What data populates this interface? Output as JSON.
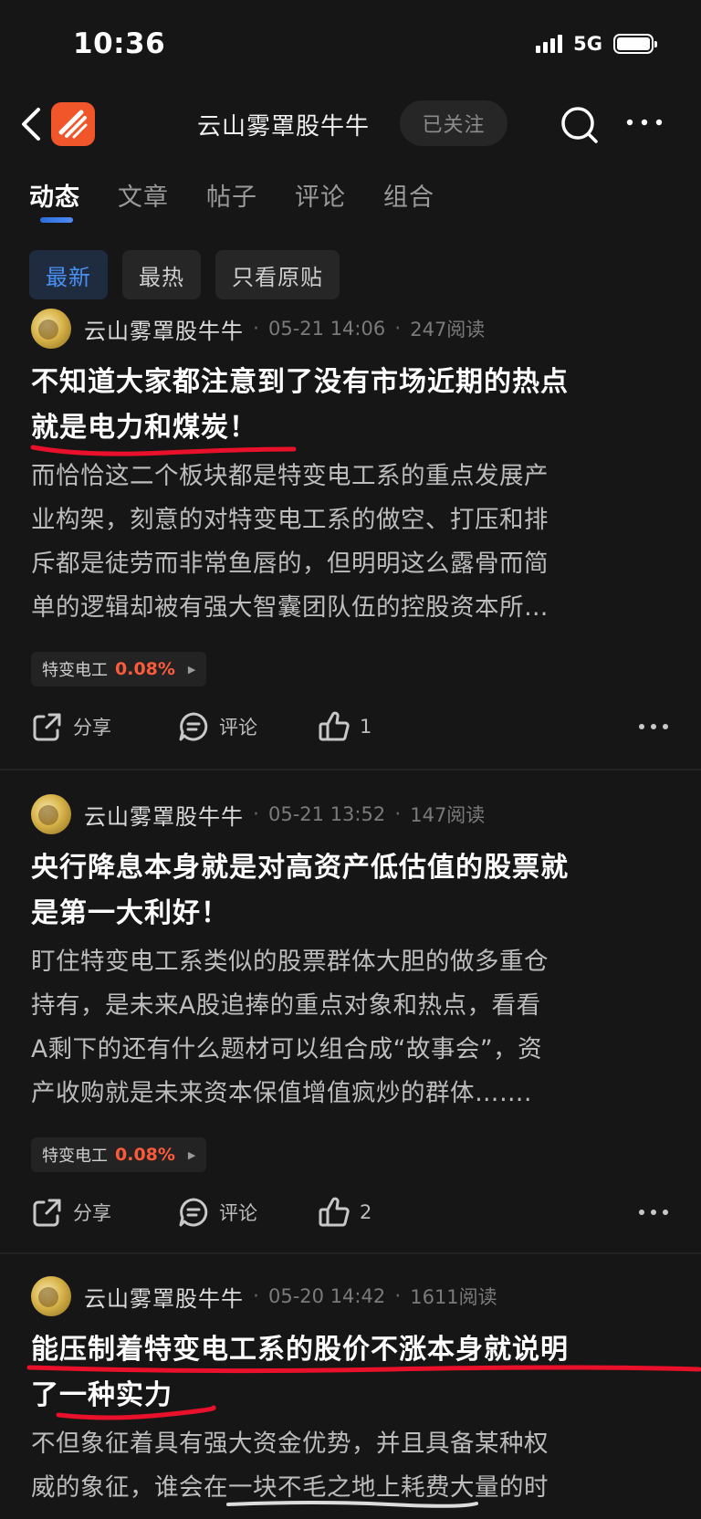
{
  "status_bar": {
    "time": "10:36",
    "network": "5G"
  },
  "header": {
    "title": "云山雾罩股牛牛",
    "follow_label": "已关注"
  },
  "tabs": [
    {
      "label": "动态",
      "active": true
    },
    {
      "label": "文章",
      "active": false
    },
    {
      "label": "帖子",
      "active": false
    },
    {
      "label": "评论",
      "active": false
    },
    {
      "label": "组合",
      "active": false
    }
  ],
  "filters": [
    {
      "label": "最新",
      "active": true
    },
    {
      "label": "最热",
      "active": false
    },
    {
      "label": "只看原贴",
      "active": false
    }
  ],
  "posts": [
    {
      "author": "云山雾罩股牛牛",
      "time": "05-21 14:06",
      "reads": "247阅读",
      "title_lines": [
        "不知道大家都注意到了没有市场近期的热点",
        "就是电力和煤炭！"
      ],
      "body_lines": [
        "而恰恰这二个板块都是特变电工系的重点发展产",
        "业构架，刻意的对特变电工系的做空、打压和排",
        "斥都是徒劳而非常鱼唇的，但明明这么露骨而简",
        "单的逻辑却被有强大智囊团队伍的控股资本所…"
      ],
      "stock": {
        "name": "特变电工",
        "change": "0.08%"
      },
      "share_label": "分享",
      "comment_label": "评论",
      "like_count": "1"
    },
    {
      "author": "云山雾罩股牛牛",
      "time": "05-21 13:52",
      "reads": "147阅读",
      "title_lines": [
        "央行降息本身就是对高资产低估值的股票就",
        "是第一大利好！"
      ],
      "body_lines": [
        "盯住特变电工系类似的股票群体大胆的做多重仓",
        "持有，是未来A股追捧的重点对象和热点，看看",
        "A剩下的还有什么题材可以组合成“故事会”，资",
        "产收购就是未来资本保值增值疯炒的群体……."
      ],
      "stock": {
        "name": "特变电工",
        "change": "0.08%"
      },
      "share_label": "分享",
      "comment_label": "评论",
      "like_count": "2"
    },
    {
      "author": "云山雾罩股牛牛",
      "time": "05-20 14:42",
      "reads": "1611阅读",
      "title_lines": [
        "能压制着特变电工系的股价不涨本身就说明",
        "了一种实力"
      ],
      "body_lines": [
        "不但象征着具有强大资金优势，并且具备某种权",
        "威的象征，谁会在一块不毛之地上耗费大量的时"
      ]
    }
  ],
  "colors": {
    "accent_blue": "#4a8ff2",
    "stock_up": "#ff5a3c",
    "annotation_red": "#e8102a",
    "logo_orange": "#f0562a"
  }
}
